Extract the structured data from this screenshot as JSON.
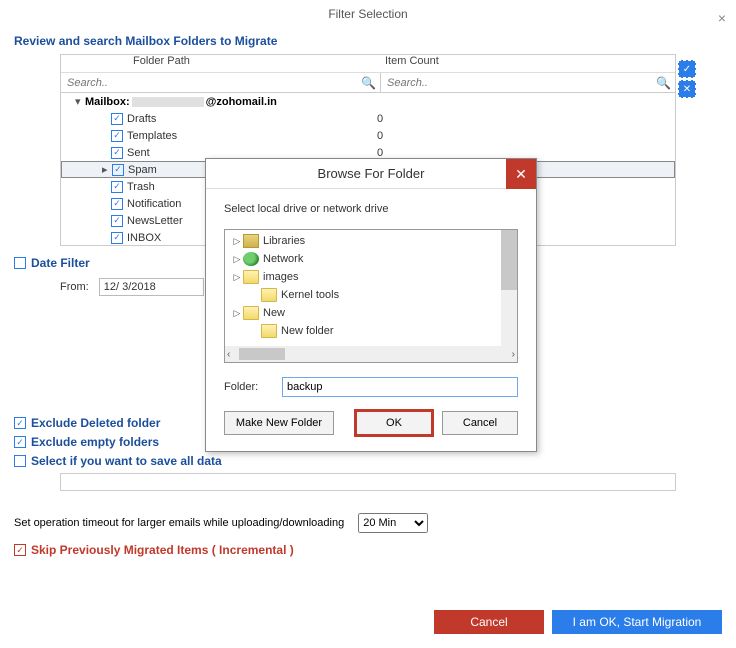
{
  "window": {
    "title": "Filter Selection"
  },
  "header": "Review and search Mailbox Folders to Migrate",
  "table": {
    "col_path": "Folder Path",
    "col_count": "Item Count",
    "search_placeholder": "Search..",
    "mailbox_prefix": "Mailbox:",
    "mailbox_suffix": "@zohomail.in",
    "rows": [
      {
        "name": "Drafts",
        "count": "0",
        "checked": true
      },
      {
        "name": "Templates",
        "count": "0",
        "checked": true
      },
      {
        "name": "Sent",
        "count": "0",
        "checked": true
      },
      {
        "name": "Spam",
        "count": "",
        "checked": true,
        "selected": true
      },
      {
        "name": "Trash",
        "count": "",
        "checked": true
      },
      {
        "name": "Notification",
        "count": "",
        "checked": true
      },
      {
        "name": "NewsLetter",
        "count": "",
        "checked": true
      },
      {
        "name": "INBOX",
        "count": "",
        "checked": true
      }
    ]
  },
  "date_filter": {
    "label": "Date Filter",
    "from_label": "From:",
    "from_value": "12/  3/2018"
  },
  "opts": {
    "excl_deleted": "Exclude Deleted folder",
    "excl_empty": "Exclude empty folders",
    "save_all": "Select if you want to save all data"
  },
  "timeout": {
    "label": "Set operation timeout for larger emails while uploading/downloading",
    "value": "20 Min"
  },
  "skip": "Skip Previously Migrated Items ( Incremental )",
  "footer": {
    "cancel": "Cancel",
    "start": "I am OK, Start Migration"
  },
  "dialog": {
    "title": "Browse For Folder",
    "instr": "Select local drive or network drive",
    "nodes": [
      {
        "label": "Libraries",
        "icon": "lib",
        "exp": true
      },
      {
        "label": "Network",
        "icon": "net",
        "exp": true
      },
      {
        "label": "images",
        "icon": "fld",
        "exp": true
      },
      {
        "label": "Kernel tools",
        "icon": "fld",
        "exp": false,
        "indent": 1
      },
      {
        "label": "New",
        "icon": "fld",
        "exp": true
      },
      {
        "label": "New folder",
        "icon": "fld",
        "exp": false,
        "indent": 1
      }
    ],
    "folder_label": "Folder:",
    "folder_value": "backup",
    "btn_make": "Make New Folder",
    "btn_ok": "OK",
    "btn_cancel": "Cancel"
  }
}
